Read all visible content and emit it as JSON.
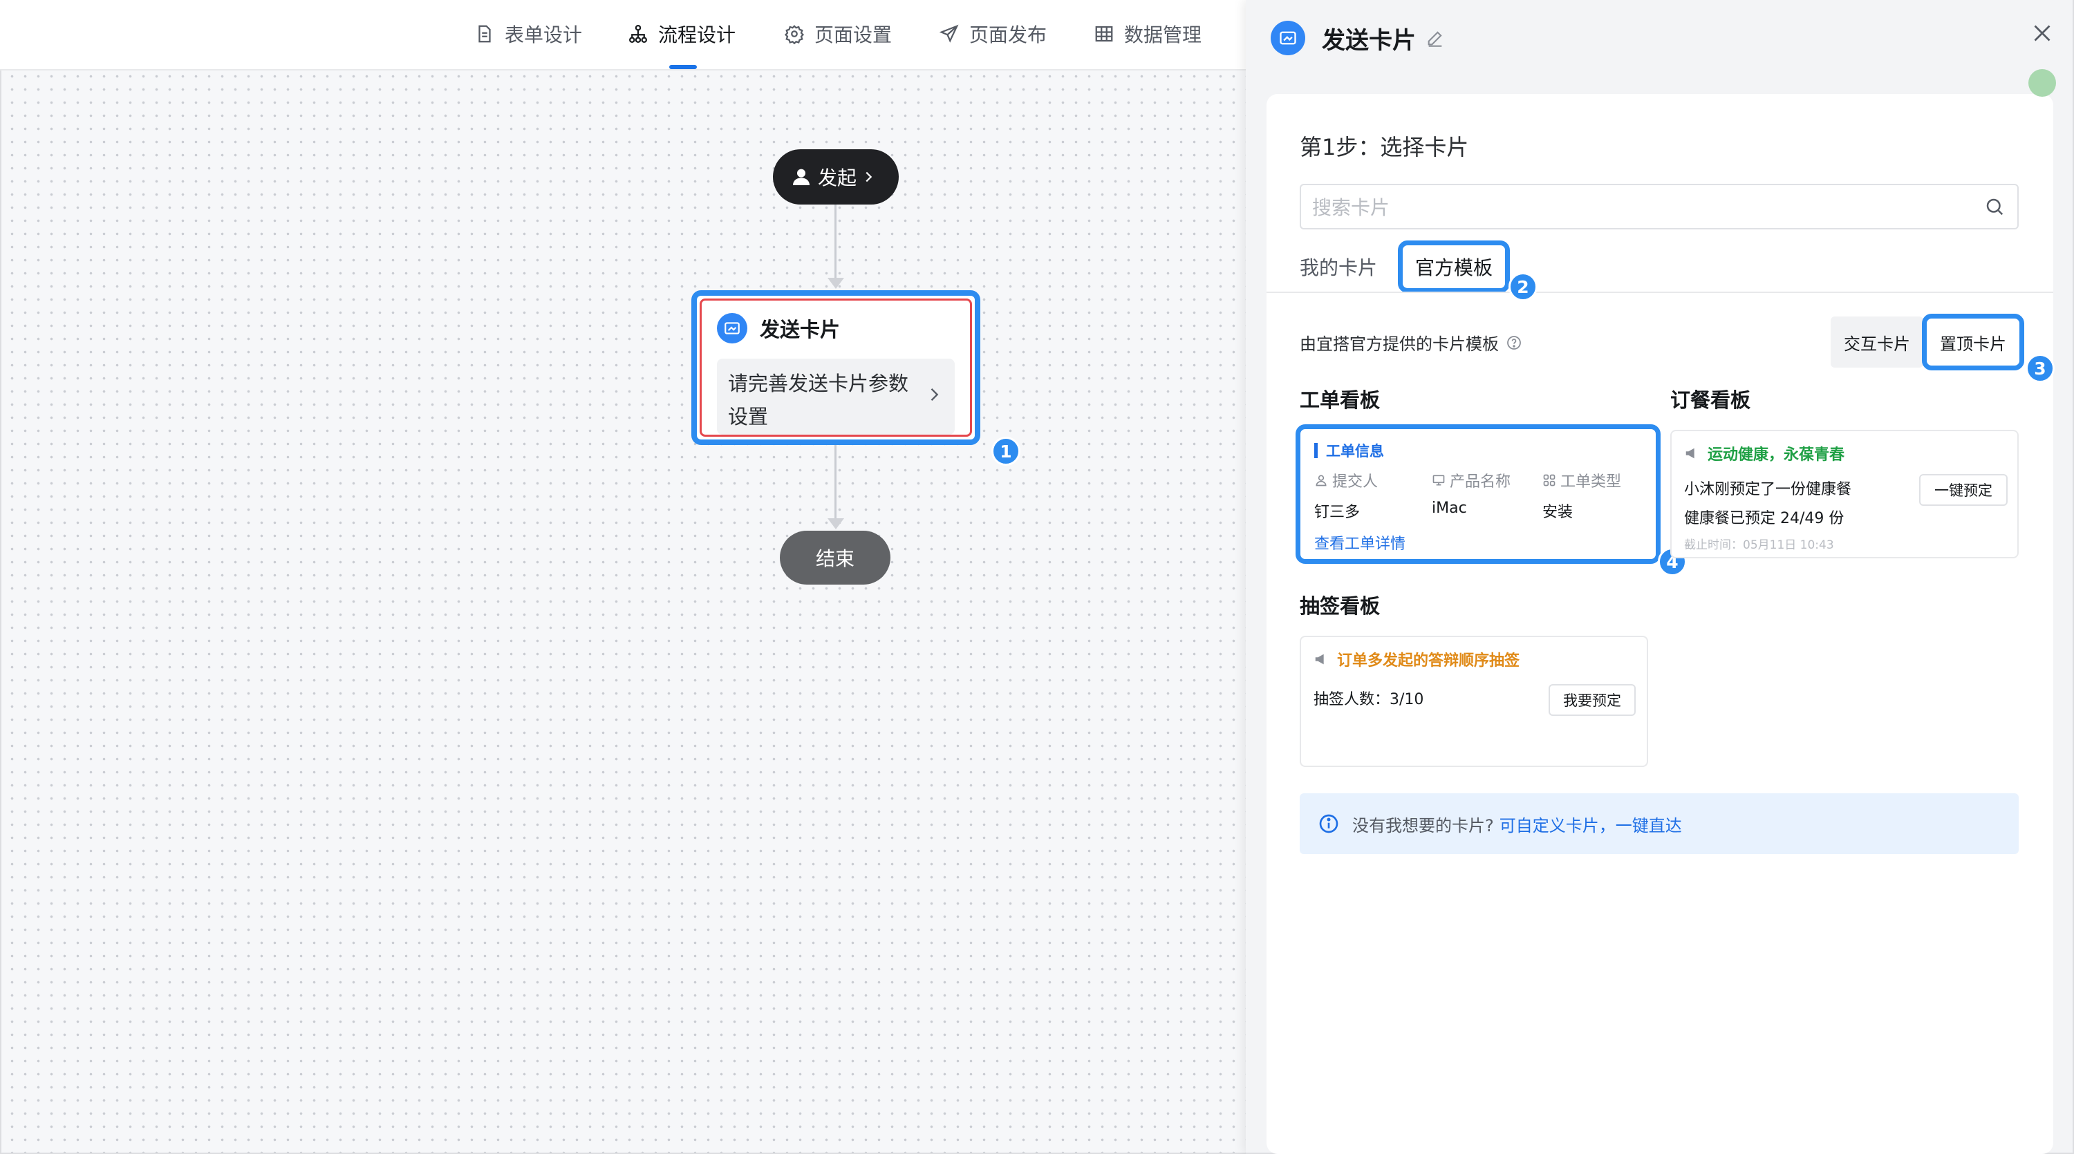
{
  "nav": {
    "tabs": [
      {
        "label": "表单设计",
        "icon": "document-icon"
      },
      {
        "label": "流程设计",
        "icon": "flow-icon",
        "active": true
      },
      {
        "label": "页面设置",
        "icon": "gear-icon"
      },
      {
        "label": "页面发布",
        "icon": "send-icon"
      },
      {
        "label": "数据管理",
        "icon": "grid-icon"
      }
    ]
  },
  "flow": {
    "start_label": "发起",
    "card_title": "发送卡片",
    "card_body": "请完善发送卡片参数设置",
    "end_label": "结束"
  },
  "badges": [
    "1",
    "2",
    "3",
    "4"
  ],
  "panel": {
    "title": "发送卡片",
    "step_title": "第1步：选择卡片",
    "search_placeholder": "搜索卡片",
    "tabs": {
      "mine": "我的卡片",
      "official": "官方模板"
    },
    "desc": "由宜搭官方提供的卡片模板",
    "filters": {
      "interactive": "交互卡片",
      "pinned": "置顶卡片"
    },
    "sections": {
      "workorder": {
        "title": "工单看板",
        "card": {
          "header": "工单信息",
          "cols": [
            {
              "label": "提交人",
              "value": "钉三多",
              "icon": "person-icon"
            },
            {
              "label": "产品名称",
              "value": "iMac",
              "icon": "monitor-icon"
            },
            {
              "label": "工单类型",
              "value": "安装",
              "icon": "grid-icon"
            }
          ],
          "link": "查看工单详情"
        }
      },
      "meal": {
        "title": "订餐看板",
        "card": {
          "header": "运动健康，永葆青春",
          "line1": "小沐刚预定了一份健康餐",
          "line2": "健康餐已预定 24/49 份",
          "button": "一键预定",
          "deadline": "截止时间：05月11日 10:43"
        }
      },
      "lottery": {
        "title": "抽签看板",
        "card": {
          "header": "订单多发起的答辩顺序抽签",
          "line1": "抽签人数：3/10",
          "button": "我要预定"
        }
      }
    },
    "info": {
      "text": "没有我想要的卡片?",
      "link": "可自定义卡片，一键直达"
    }
  },
  "colors": {
    "accent": "#2d8cf0",
    "green": "#1fa045",
    "orange": "#e08a18"
  }
}
